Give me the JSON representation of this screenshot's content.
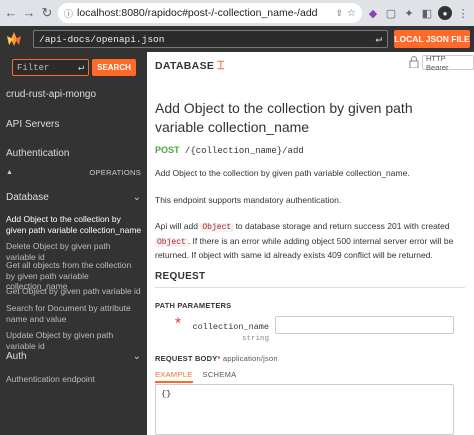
{
  "browser": {
    "url": "localhost:8080/rapidoc#post-/-collection_name-/add"
  },
  "header": {
    "spec_url": "/api-docs/openapi.json",
    "local_json_label": "LOCAL JSON FILE"
  },
  "sidebar": {
    "filter_placeholder": "Filter",
    "search_label": "SEARCH",
    "api_title": "crud-rust-api-mongo",
    "api_servers": "API Servers",
    "authentication": "Authentication",
    "operations_label": "OPERATIONS",
    "database_section": "Database",
    "items": [
      "Add Object to the collection by given path variable collection_name",
      "Delete Object by given path variable id",
      "Get all objects from the collection by given path variable collection_name",
      "Get Object by given path variable id",
      "Search for Document by attribute name and value",
      "Update Object by given path variable id"
    ],
    "auth_section": "Auth",
    "auth_items": [
      "Authentication endpoint"
    ]
  },
  "main": {
    "tag": "DATABASE",
    "auth_badge": "HTTP Bearer",
    "title": "Add Object to the collection by given path variable collection_name",
    "method": "POST",
    "path": "/{collection_name}/add",
    "summary": "Add Object to the collection by given path variable collection_name.",
    "auth_note": "This endpoint supports mandatory authentication.",
    "desc_part1": "Api will add",
    "desc_code1": "Object",
    "desc_part2": "to database storage and return success 201 with created",
    "desc_code2": "Object",
    "desc_part3": ". If there is an error while adding object 500 internal server error will be returned. If object with same id already exists 409 conflict will be returned.",
    "request_label": "REQUEST",
    "path_params_label": "PATH PARAMETERS",
    "param_name": "collection_name",
    "param_type": "string",
    "request_body_label": "REQUEST BODY",
    "request_body_mime": "application/json",
    "tab_example": "EXAMPLE",
    "tab_schema": "SCHEMA",
    "body_example": "{}"
  },
  "colors": {
    "accent": "#ff6a2b",
    "post_method": "#4aaa3a",
    "sidebar_bg": "#333333"
  }
}
